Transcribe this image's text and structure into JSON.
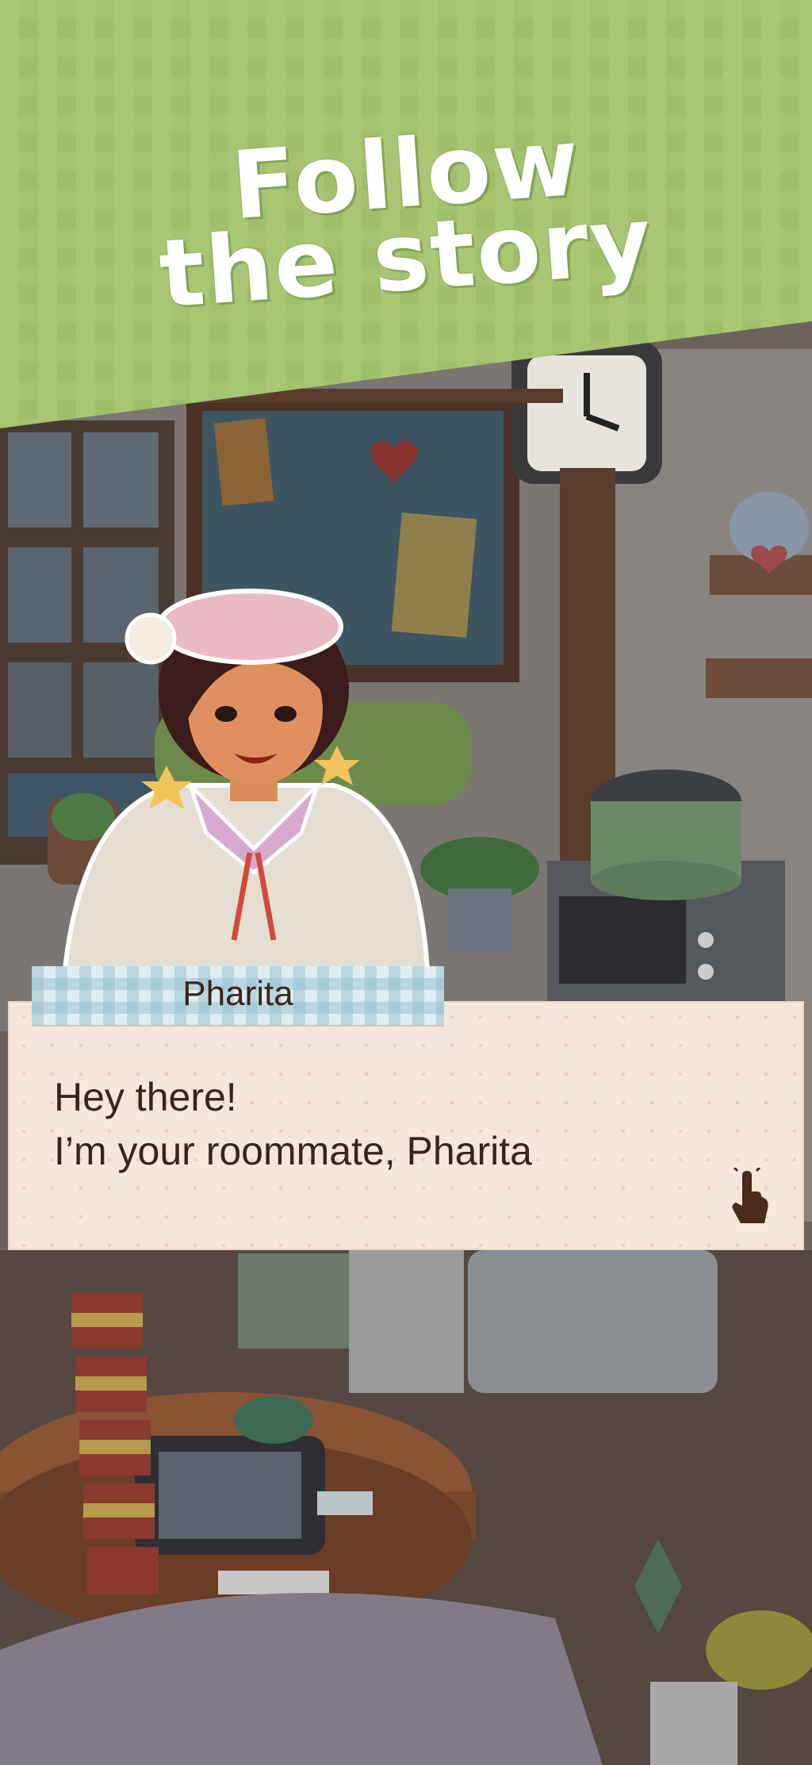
{
  "headline": {
    "line1": "Follow",
    "line2": "the story"
  },
  "dialog": {
    "speaker": "Pharita",
    "lines": [
      "Hey there!",
      "I’m your roommate, Pharita"
    ]
  },
  "icons": {
    "continue": "tap-hand-icon"
  },
  "colors": {
    "banner_green": "#9dbf6a",
    "dialog_bg": "#f6e7da",
    "text_brown": "#3b2616",
    "nametag_blue": "#dfeef3"
  }
}
